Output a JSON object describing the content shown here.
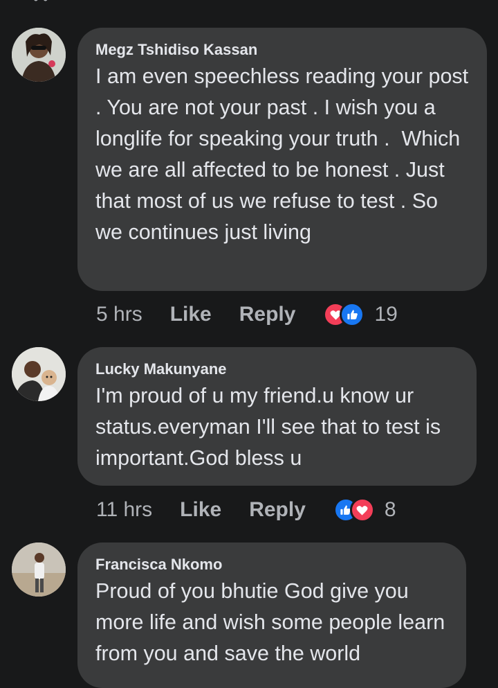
{
  "comments": [
    {
      "author": "Megz Tshidiso Kassan",
      "text": "I am even speechless reading your post . You are not your past . I wish you a longlife for speaking your truth .  Which we are all affected to be honest . Just that most of us we refuse to test . So we continues just living",
      "time": "5 hrs",
      "like_label": "Like",
      "reply_label": "Reply",
      "reactions": [
        "heart-icon",
        "thumbs-up-icon"
      ],
      "reaction_count": "19"
    },
    {
      "author": "Lucky Makunyane",
      "text": "I'm proud of u my friend.u know ur status.everyman I'll see that to test is important.God bless u",
      "time": "11 hrs",
      "like_label": "Like",
      "reply_label": "Reply",
      "reactions": [
        "thumbs-up-icon",
        "heart-icon"
      ],
      "reaction_count": "8"
    },
    {
      "author": "Francisca Nkomo",
      "text": "Proud of you bhutie God give you more life and wish some people learn from you and save the world"
    }
  ],
  "colors": {
    "background": "#18191a",
    "bubble": "#3a3b3c",
    "text": "#e4e6eb",
    "secondary_text": "#b0b3b8",
    "love": "#f33e58",
    "like": "#1877f2"
  }
}
